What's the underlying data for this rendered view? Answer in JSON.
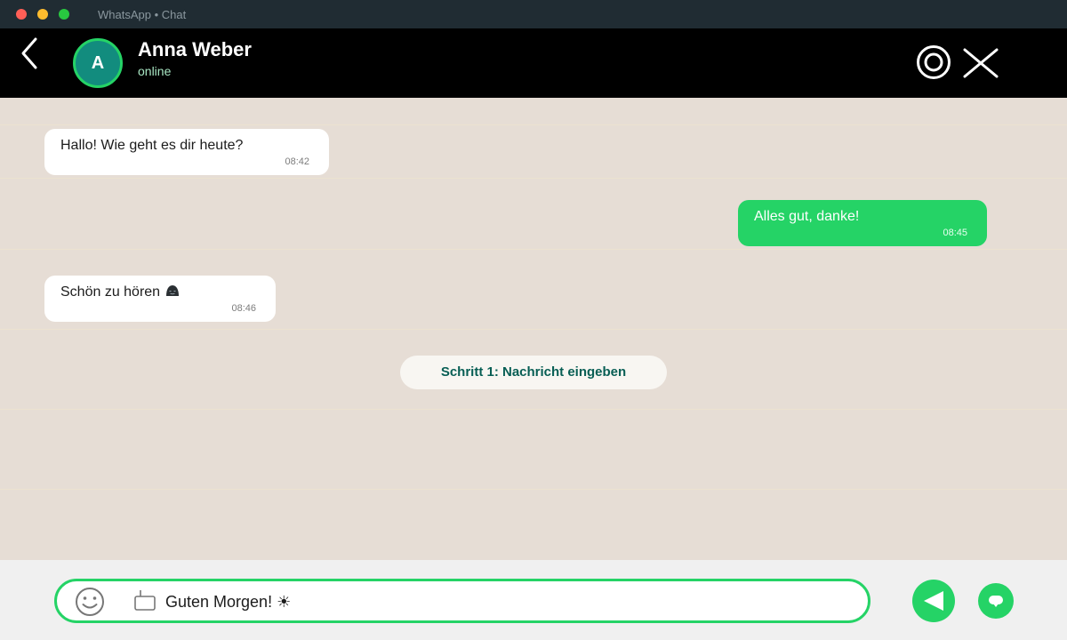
{
  "window": {
    "title": "WhatsApp • Chat"
  },
  "header": {
    "avatar_initial": "A",
    "contact_name": "Anna Weber",
    "status": "online",
    "icons": [
      "back-arrow-icon",
      "camera-icon",
      "close-icon"
    ]
  },
  "messages": [
    {
      "direction": "incoming",
      "text": "Hallo! Wie geht es dir heute?",
      "time": "08:42"
    },
    {
      "direction": "outgoing",
      "text": "Alles gut, danke!",
      "time": "08:45"
    },
    {
      "direction": "incoming",
      "text": "Schön zu hören",
      "time": "08:46",
      "emoji": "smiling-face-icon"
    }
  ],
  "hint": {
    "label": "Schritt 1: Nachricht eingeben"
  },
  "composer": {
    "value": "Guten Morgen! ☀",
    "icons": [
      "emoji-icon",
      "attach-icon",
      "send-icon",
      "voice-icon"
    ]
  },
  "colors": {
    "accent": "#25d366",
    "header_bg": "#000000",
    "chat_bg": "#e6ddd5",
    "avatar_bg": "#128c7e",
    "hint_text": "#075e54"
  }
}
